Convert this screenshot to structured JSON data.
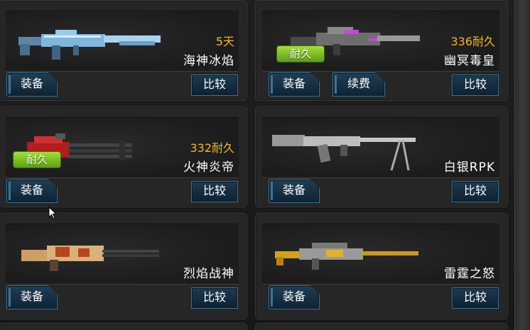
{
  "buttons": {
    "equip": "装备",
    "compare": "比较",
    "renew": "续费"
  },
  "badges": {
    "durable": "耐久"
  },
  "weapons": [
    {
      "name": "海神冰焰",
      "duration": "5天",
      "icon": "blue-ice-rifle-icon"
    },
    {
      "name": "幽冥毒皇",
      "duration": "336耐久",
      "icon": "dark-poison-rifle-icon"
    },
    {
      "name": "火神炎帝",
      "duration": "332耐久",
      "icon": "red-gatling-gun-icon"
    },
    {
      "name": "白银RPK",
      "duration": "",
      "icon": "silver-rpk-icon"
    },
    {
      "name": "烈焰战神",
      "duration": "",
      "icon": "flame-minigun-icon"
    },
    {
      "name": "雷霆之怒",
      "duration": "",
      "icon": "gold-sniper-rifle-icon"
    }
  ],
  "colors": {
    "duration": "#f3b51c",
    "durable_badge": "#7fc226",
    "button_border": "#3d7394"
  }
}
